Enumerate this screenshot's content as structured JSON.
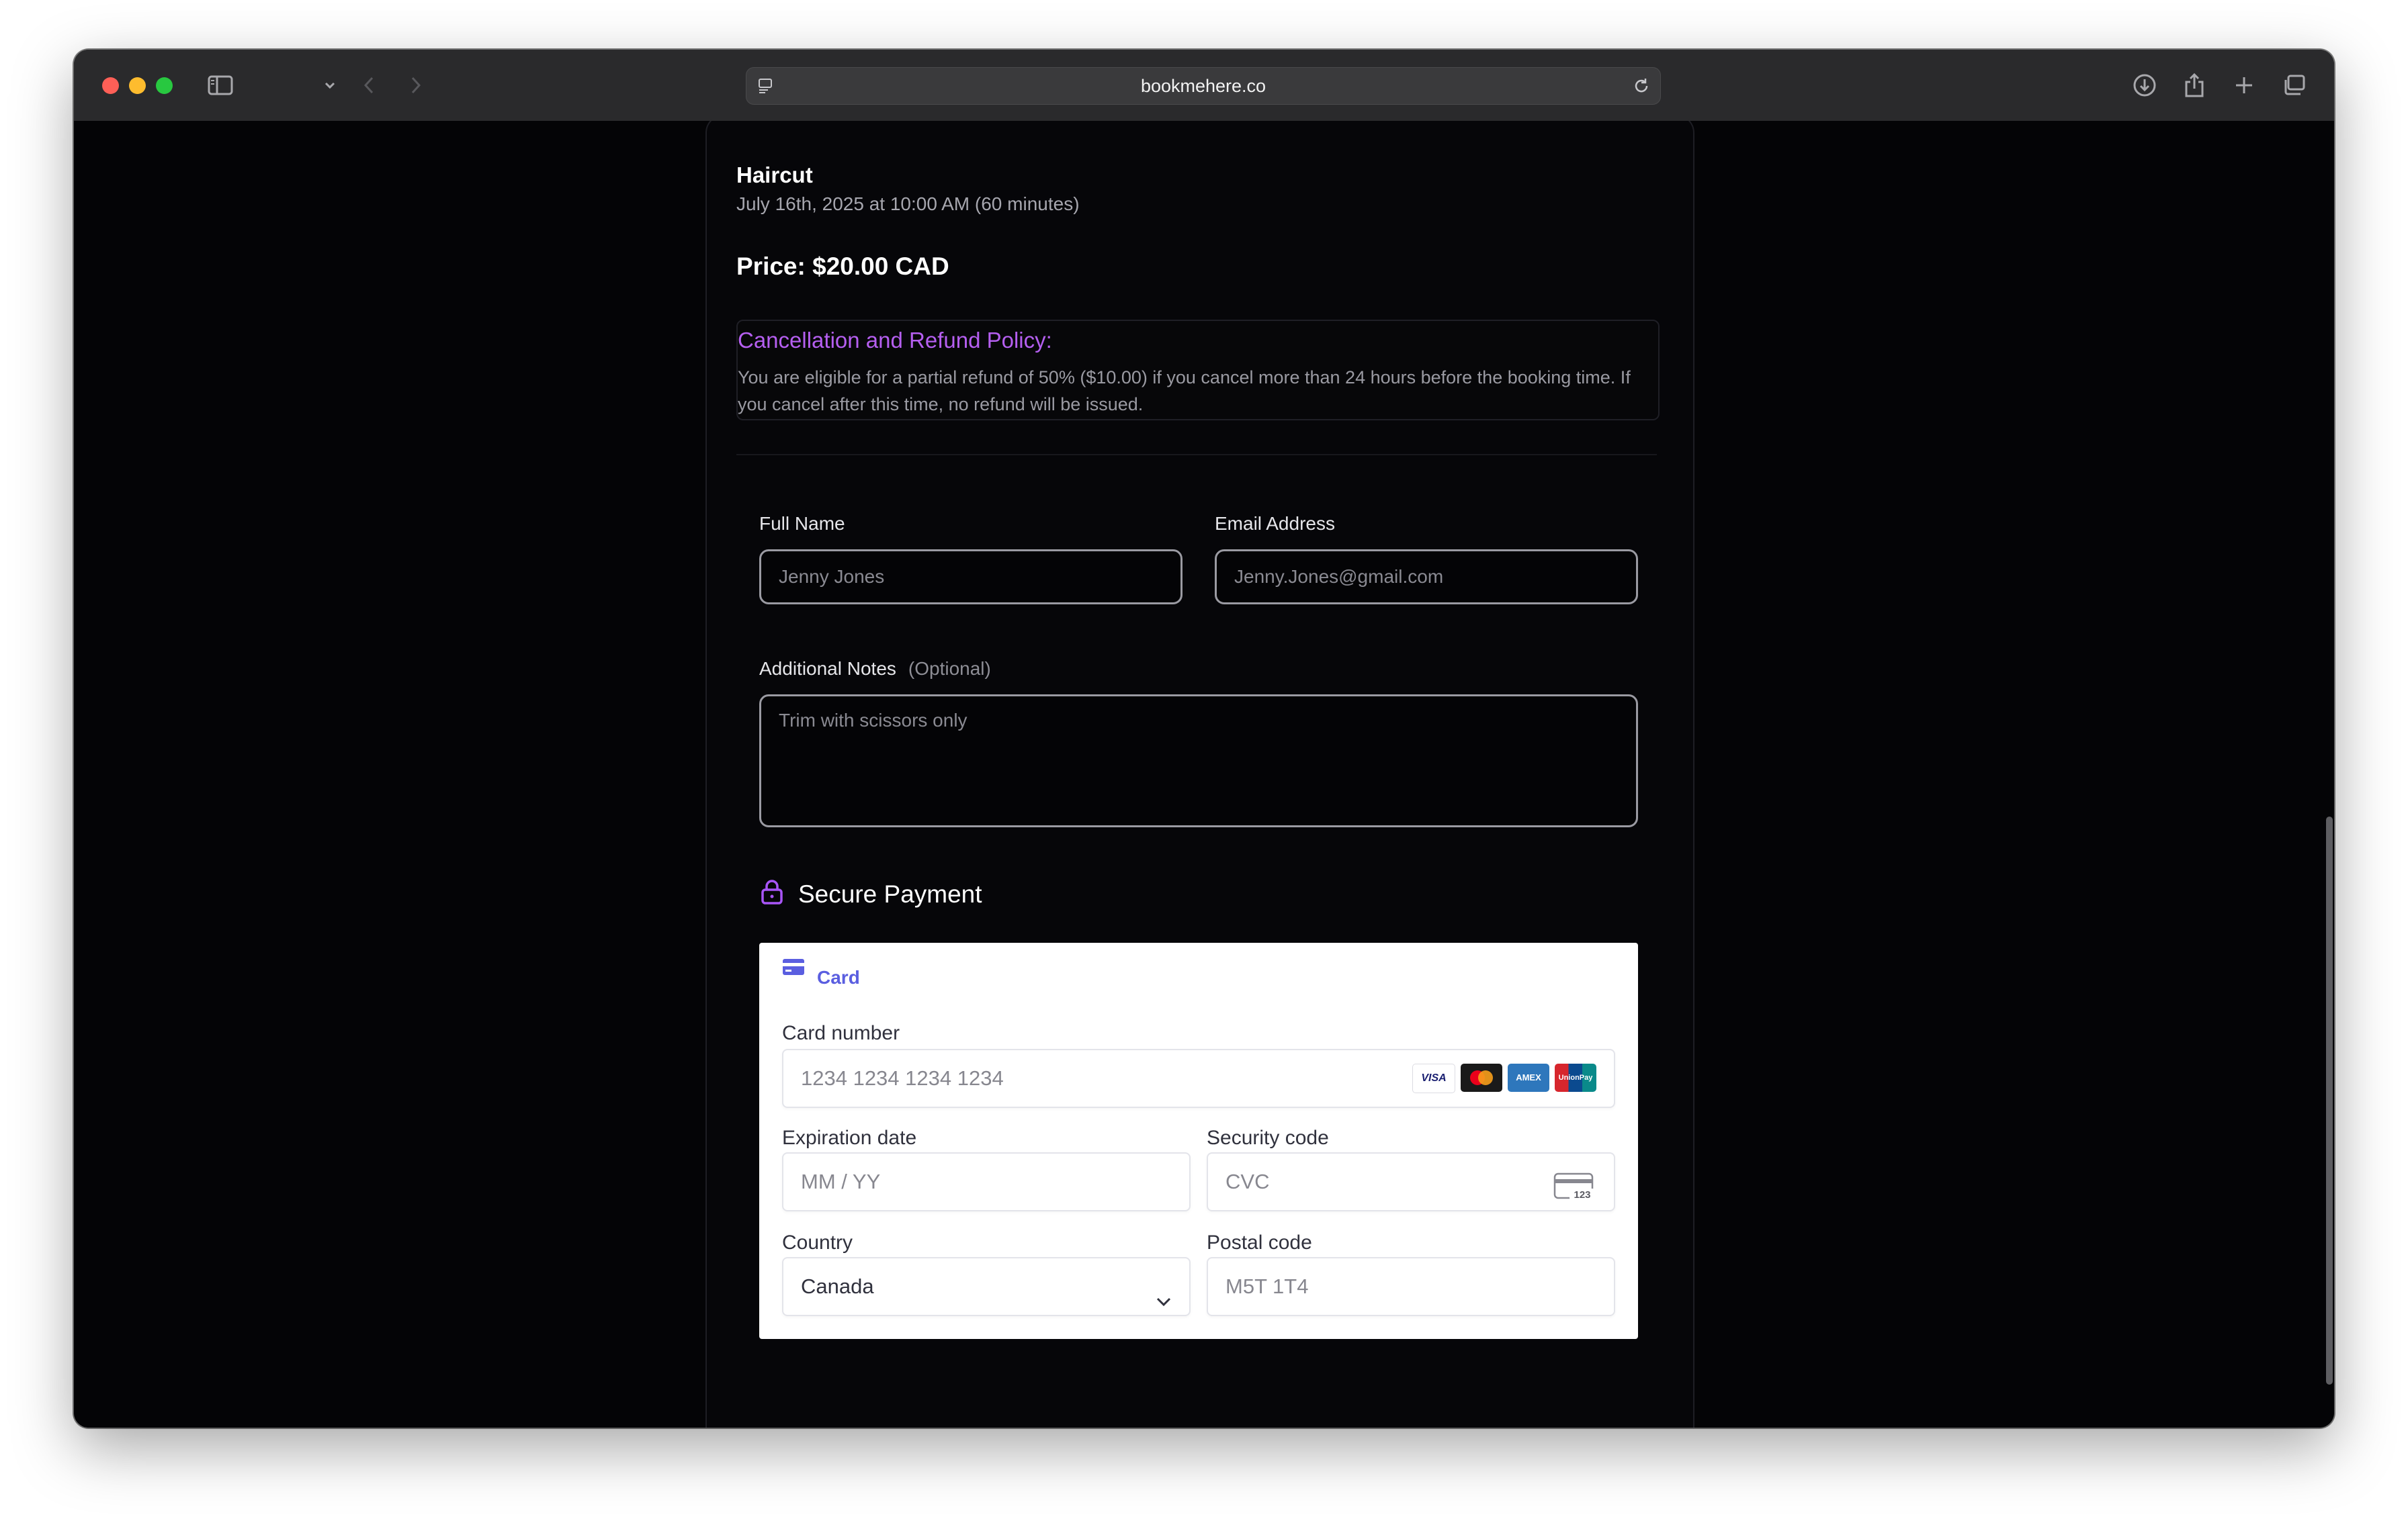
{
  "browser": {
    "url": "bookmehere.co"
  },
  "booking": {
    "service": "Haircut",
    "when": "July 16th, 2025 at 10:00 AM (60 minutes)",
    "price": "Price: $20.00 CAD"
  },
  "policy": {
    "title": "Cancellation and Refund Policy:",
    "text": "You are eligible for a partial refund of 50% ($10.00) if you cancel more than 24 hours before the booking time. If you cancel after this time, no refund will be issued."
  },
  "form": {
    "full_name_label": "Full Name",
    "full_name_placeholder": "Jenny Jones",
    "email_label": "Email Address",
    "email_placeholder": "Jenny.Jones@gmail.com",
    "notes_label": "Additional Notes",
    "notes_optional": "(Optional)",
    "notes_placeholder": "Trim with scissors only"
  },
  "payment": {
    "heading": "Secure Payment",
    "tab_label": "Card",
    "card_number_label": "Card number",
    "card_number_placeholder": "1234 1234 1234 1234",
    "card_brands": [
      "VISA",
      "Mastercard",
      "AMEX",
      "UnionPay"
    ],
    "expiration_label": "Expiration date",
    "expiration_placeholder": "MM / YY",
    "security_label": "Security code",
    "security_placeholder": "CVC",
    "cvc_icon_text": "123",
    "country_label": "Country",
    "country_value": "Canada",
    "postal_label": "Postal code",
    "postal_placeholder": "M5T 1T4"
  },
  "colors": {
    "accent": "#a855f7",
    "policy_title": "#b55ff0",
    "stripe_tab": "#5a5ee0"
  }
}
